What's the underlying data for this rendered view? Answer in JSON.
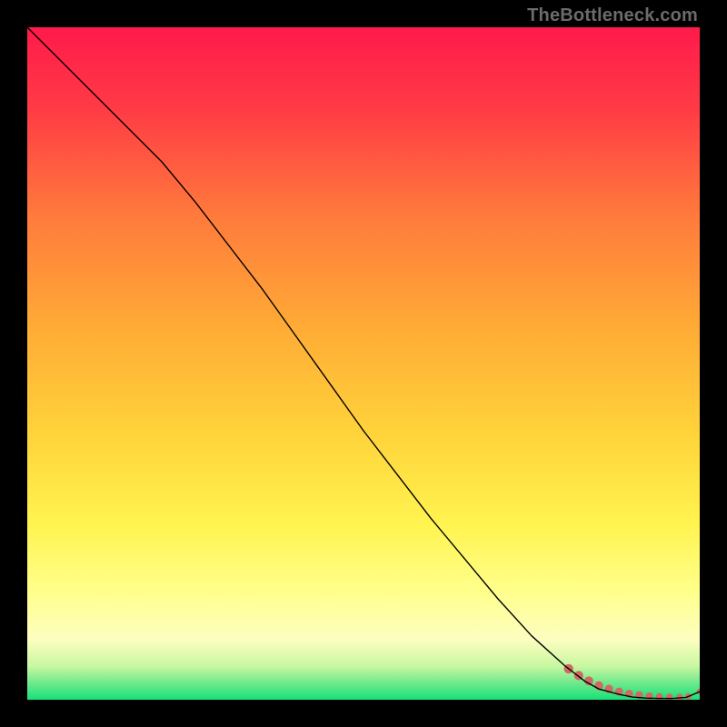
{
  "watermark": "TheBottleneck.com",
  "chart_data": {
    "type": "line",
    "title": "",
    "xlabel": "",
    "ylabel": "",
    "xlim": [
      0,
      100
    ],
    "ylim": [
      0,
      100
    ],
    "grid": false,
    "legend": false,
    "background_gradient": {
      "top_color": "#ff1a4b",
      "mid_colors": [
        "#ff7a3c",
        "#ffd23a",
        "#ffff66",
        "#fdfec0"
      ],
      "bottom_color": "#18e07a"
    },
    "series": [
      {
        "name": "bottleneck-curve",
        "color": "#000000",
        "stroke_width": 1.4,
        "x": [
          0,
          5,
          10,
          15,
          20,
          25,
          30,
          35,
          40,
          45,
          50,
          55,
          60,
          65,
          70,
          75,
          80,
          83,
          85,
          88,
          90,
          92,
          94,
          96,
          98,
          100
        ],
        "y": [
          100,
          95,
          90,
          85,
          80,
          74,
          67.5,
          61,
          54,
          47,
          40,
          33.5,
          27,
          21,
          15,
          9.5,
          5,
          2.7,
          1.6,
          0.8,
          0.4,
          0.25,
          0.2,
          0.2,
          0.35,
          1.2
        ]
      }
    ],
    "markers": {
      "name": "optimal-zone-points",
      "color": "#cf6a63",
      "radius_start": 5.2,
      "radius_end": 3.4,
      "x": [
        80.5,
        82.0,
        83.5,
        85.0,
        86.5,
        88.0,
        89.5,
        91.0,
        92.5,
        94.0,
        95.5,
        97.0,
        98.3,
        100.0
      ],
      "y": [
        4.6,
        3.6,
        2.8,
        2.1,
        1.6,
        1.2,
        0.9,
        0.7,
        0.55,
        0.45,
        0.4,
        0.4,
        0.5,
        1.2
      ]
    }
  }
}
